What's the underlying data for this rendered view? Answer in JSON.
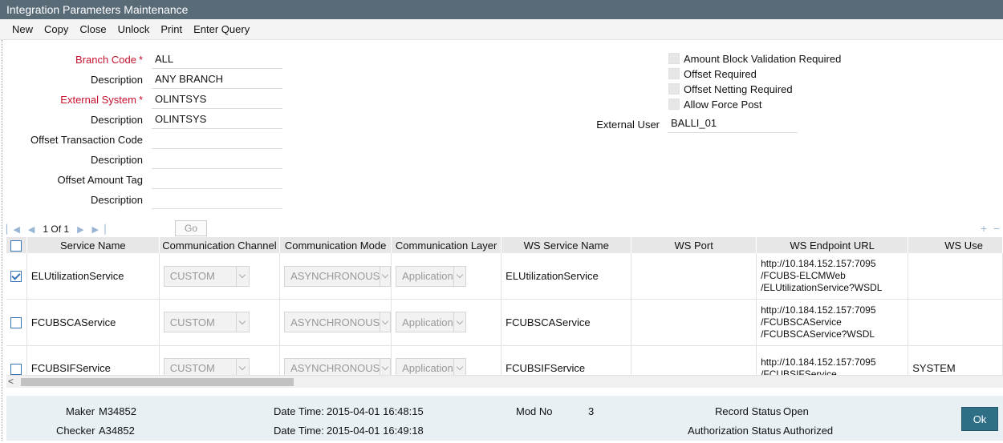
{
  "window": {
    "title": "Integration Parameters Maintenance"
  },
  "toolbar": {
    "items": [
      "New",
      "Copy",
      "Close",
      "Unlock",
      "Print",
      "Enter Query"
    ]
  },
  "form": {
    "branch_code": {
      "label": "Branch Code",
      "value": "ALL"
    },
    "branch_desc": {
      "label": "Description",
      "value": "ANY BRANCH"
    },
    "external_system": {
      "label": "External System",
      "value": "OLINTSYS"
    },
    "ext_sys_desc": {
      "label": "Description",
      "value": "OLINTSYS"
    },
    "offset_txn_code": {
      "label": "Offset Transaction Code",
      "value": ""
    },
    "offset_txn_desc": {
      "label": "Description",
      "value": ""
    },
    "offset_amount_tag": {
      "label": "Offset Amount Tag",
      "value": ""
    },
    "offset_amt_desc": {
      "label": "Description",
      "value": ""
    },
    "required_marker": "*"
  },
  "options": {
    "amount_block": "Amount Block Validation Required",
    "offset_required": "Offset Required",
    "offset_netting": "Offset Netting Required",
    "allow_force_post": "Allow Force Post",
    "external_user_label": "External User",
    "external_user_value": "BALLI_01"
  },
  "grid": {
    "pager": {
      "page_text": "1 Of 1",
      "go_label": "Go",
      "add": "+",
      "remove": "−"
    },
    "columns": [
      "Service Name",
      "Communication Channel",
      "Communication Mode",
      "Communication Layer",
      "WS Service Name",
      "WS Port",
      "WS Endpoint URL",
      "WS Use"
    ],
    "rows": [
      {
        "checked": true,
        "service": "ELUtilizationService",
        "channel": "CUSTOM",
        "mode": "ASYNCHRONOUS",
        "layer": "Application",
        "ws_service": "ELUtilizationService",
        "ws_port": "",
        "url1": "http://10.184.152.157:7095",
        "url2": "/FCUBS-ELCMWeb",
        "url3": "/ELUtilizationService?WSDL",
        "ws_user": ""
      },
      {
        "checked": false,
        "service": "FCUBSCAService",
        "channel": "CUSTOM",
        "mode": "ASYNCHRONOUS",
        "layer": "Application",
        "ws_service": "FCUBSCAService",
        "ws_port": "",
        "url1": "http://10.184.152.157:7095",
        "url2": "/FCUBSCAService",
        "url3": "/FCUBSCAService?WSDL",
        "ws_user": ""
      },
      {
        "checked": false,
        "service": "FCUBSIFService",
        "channel": "CUSTOM",
        "mode": "ASYNCHRONOUS",
        "layer": "Application",
        "ws_service": "FCUBSIFService",
        "ws_port": "",
        "url1": "http://10.184.152.157:7095",
        "url2": "/FCUBSIFService",
        "url3": "",
        "ws_user": "SYSTEM"
      }
    ]
  },
  "footer": {
    "maker_label": "Maker",
    "maker_value": "M34852",
    "checker_label": "Checker",
    "checker_value": "A34852",
    "dt_label": "Date Time:",
    "maker_dt": "2015-04-01 16:48:15",
    "checker_dt": "2015-04-01 16:49:18",
    "mod_label": "Mod No",
    "mod_value": "3",
    "record_status_label": "Record Status",
    "record_status_value": "Open",
    "auth_status_label": "Authorization Status",
    "auth_status_value": "Authorized",
    "ok_label": "Ok"
  }
}
